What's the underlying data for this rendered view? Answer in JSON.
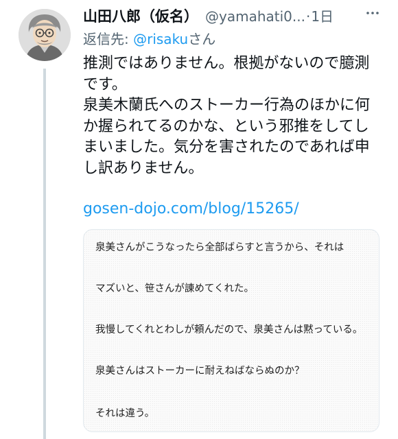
{
  "tweet": {
    "display_name": "山田八郎（仮名）",
    "handle": "@yamahati0...",
    "separator": "·",
    "time": "1日",
    "reply_prefix": "返信先: ",
    "reply_mention": "@risaku",
    "reply_suffix": "さん",
    "body_lines": [
      "推測ではありません。根拠がないので臆測",
      "です。",
      "泉美木蘭氏へのストーカー行為のほかに何",
      "か握られてるのかな、という邪推をしてし",
      "まいました。気分を害されたのであれば申",
      "し訳ありません。"
    ],
    "link": "gosen-dojo.com/blog/15265/"
  },
  "card": {
    "lines": [
      "泉美さんがこうなったら全部ばらすと言うから、それは",
      "マズいと、笹さんが諌めてくれた。",
      "我慢してくれとわしが頼んだので、泉美さんは黙っている。",
      "泉美さんはストーカーに耐えねばならぬのか？",
      "それは違う。"
    ]
  },
  "icons": {
    "avatar": "avatar-illustration",
    "more": "more-icon"
  },
  "colors": {
    "link": "#1d9bf0",
    "secondary_text": "#536471",
    "primary_text": "#0f1419",
    "thread_line": "#cfd9de"
  }
}
